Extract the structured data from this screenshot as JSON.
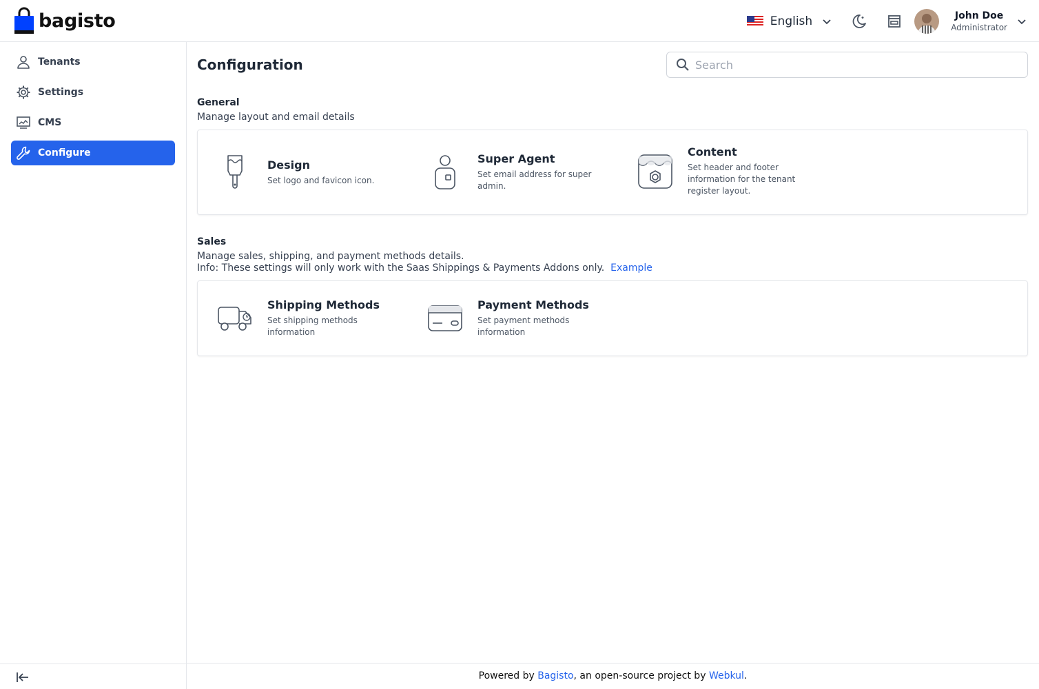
{
  "header": {
    "logo_text": "bagisto",
    "language": "English",
    "user_name": "John Doe",
    "user_role": "Administrator"
  },
  "sidebar": {
    "items": [
      {
        "label": "Tenants",
        "icon": "person-icon"
      },
      {
        "label": "Settings",
        "icon": "gear-icon"
      },
      {
        "label": "CMS",
        "icon": "monitor-icon"
      },
      {
        "label": "Configure",
        "icon": "wrench-icon",
        "active": true
      }
    ]
  },
  "main": {
    "title": "Configuration",
    "search_placeholder": "Search",
    "sections": [
      {
        "title": "General",
        "description": "Manage layout and email details",
        "items": [
          {
            "title": "Design",
            "description_lines": [
              "Set logo and favicon icon."
            ],
            "icon": "paint-brush-icon"
          },
          {
            "title": "Super Agent",
            "description_lines": [
              "Set email address for super",
              "admin."
            ],
            "icon": "agent-icon"
          },
          {
            "title": "Content",
            "description_lines": [
              "Set header and footer",
              "information for the tenant",
              "register layout."
            ],
            "icon": "storefront-settings-icon"
          }
        ]
      },
      {
        "title": "Sales",
        "description": "Manage sales, shipping, and payment methods details.",
        "info": "Info: These settings will only work with the Saas Shippings & Payments Addons only.",
        "info_link": "Example",
        "items": [
          {
            "title": "Shipping Methods",
            "description_lines": [
              "Set shipping methods",
              "information"
            ],
            "icon": "truck-icon"
          },
          {
            "title": "Payment Methods",
            "description_lines": [
              "Set payment methods",
              "information"
            ],
            "icon": "credit-card-icon"
          }
        ]
      }
    ]
  },
  "footer": {
    "prefix": "Powered by ",
    "link1": "Bagisto",
    "middle": ", an open-source project by ",
    "link2": "Webkul",
    "suffix": "."
  },
  "colors": {
    "accent": "#2563eb",
    "border": "#e5e7eb",
    "text": "#1f2937"
  }
}
